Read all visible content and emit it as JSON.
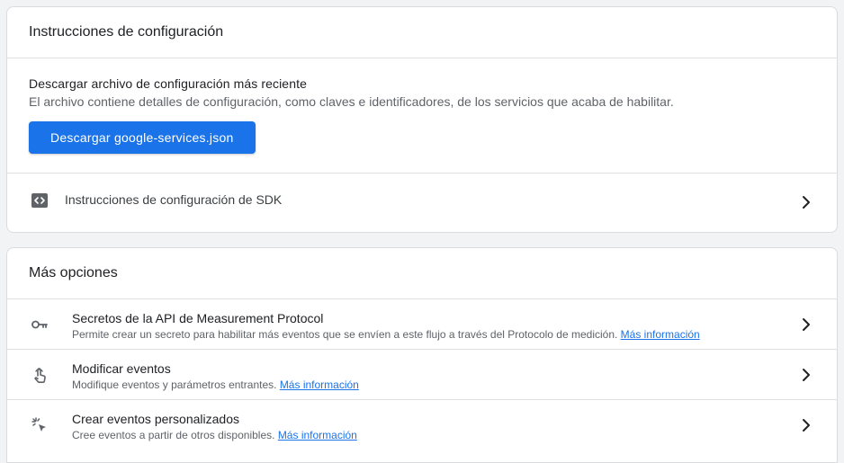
{
  "setup": {
    "title": "Instrucciones de configuración",
    "download_heading": "Descargar archivo de configuración más reciente",
    "download_desc": "El archivo contiene detalles de configuración, como claves e identificadores, de los servicios que acaba de habilitar.",
    "download_button": "Descargar google-services.json",
    "sdk_label": "Instrucciones de configuración de SDK",
    "sdk_icon": "code-icon"
  },
  "more": {
    "title": "Más opciones",
    "items": [
      {
        "icon": "key-icon",
        "title": "Secretos de la API de Measurement Protocol",
        "desc": "Permite crear un secreto para habilitar más eventos que se envíen a este flujo a través del Protocolo de medición.",
        "link": "Más información"
      },
      {
        "icon": "touch-icon",
        "title": "Modificar eventos",
        "desc": "Modifique eventos y parámetros entrantes.",
        "link": "Más información"
      },
      {
        "icon": "click-sparkle-icon",
        "title": "Crear eventos personalizados",
        "desc": "Cree eventos a partir de otros disponibles.",
        "link": "Más información"
      }
    ]
  },
  "colors": {
    "primary": "#1a73e8",
    "background": "#f1f3f4",
    "divider": "#e0e0e0"
  }
}
